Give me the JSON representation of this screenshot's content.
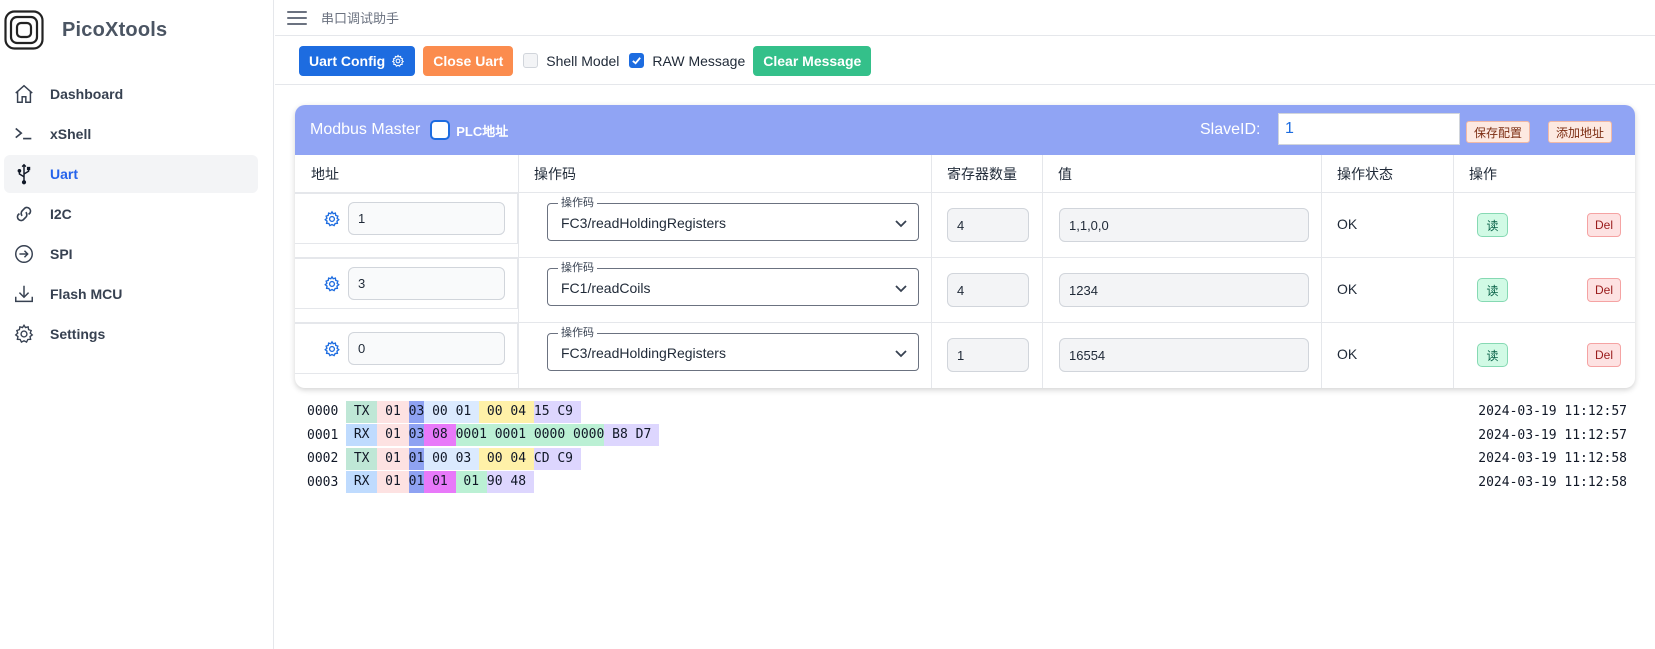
{
  "app": {
    "name": "PicoXtools",
    "header_title": "串口调试助手"
  },
  "sidebar": {
    "items": [
      {
        "label": "Dashboard",
        "icon": "home-icon"
      },
      {
        "label": "xShell",
        "icon": "terminal-icon"
      },
      {
        "label": "Uart",
        "icon": "usb-icon",
        "active": true
      },
      {
        "label": "I2C",
        "icon": "link-icon"
      },
      {
        "label": "SPI",
        "icon": "arrow-circle-icon"
      },
      {
        "label": "Flash MCU",
        "icon": "download-icon"
      },
      {
        "label": "Settings",
        "icon": "gear-icon"
      }
    ]
  },
  "toolbar": {
    "uart_config_label": "Uart Config",
    "close_uart_label": "Close Uart",
    "shell_model_label": "Shell Model",
    "shell_model_checked": false,
    "raw_message_label": "RAW Message",
    "raw_message_checked": true,
    "clear_message_label": "Clear Message"
  },
  "modbus": {
    "title": "Modbus Master",
    "plc_label": "PLC地址",
    "slave_label": "SlaveID:",
    "slave_id": "1",
    "save_config_label": "保存配置",
    "add_address_label": "添加地址",
    "columns": [
      "地址",
      "操作码",
      "寄存器数量",
      "值",
      "操作状态",
      "操作"
    ],
    "opcode_legend": "操作码",
    "read_label": "读",
    "del_label": "Del",
    "rows": [
      {
        "address": "1",
        "opcode": "FC3/readHoldingRegisters",
        "count": "4",
        "value": "1,1,0,0",
        "status": "OK"
      },
      {
        "address": "3",
        "opcode": "FC1/readCoils",
        "count": "4",
        "value": "1234",
        "status": "OK"
      },
      {
        "address": "0",
        "opcode": "FC3/readHoldingRegisters",
        "count": "1",
        "value": "16554",
        "status": "OK"
      }
    ]
  },
  "log": {
    "lines": [
      {
        "index": "0000",
        "timestamp": "2024-03-19 11:12:57",
        "segments": [
          {
            "text": " TX ",
            "color": "#bfe7d6"
          },
          {
            "text": " 01 ",
            "color": "#fde2e2"
          },
          {
            "text": "03",
            "color": "#8ea2f2"
          },
          {
            "text": " 00 01 ",
            "color": "#dbeafe"
          },
          {
            "text": " 00 04 ",
            "color": "#fff1a8"
          },
          {
            "text": "15 C9 ",
            "color": "#ddd6fe"
          }
        ]
      },
      {
        "index": "0001",
        "timestamp": "2024-03-19 11:12:57",
        "segments": [
          {
            "text": " RX ",
            "color": "#bfdbfe"
          },
          {
            "text": " 01 ",
            "color": "#fde2e2"
          },
          {
            "text": "03",
            "color": "#8ea2f2"
          },
          {
            "text": " 08 ",
            "color": "#e879f9"
          },
          {
            "text": "0001 0001 0000 0000",
            "color": "#bbf0d4"
          },
          {
            "text": " B8 D7 ",
            "color": "#ddd6fe"
          }
        ]
      },
      {
        "index": "0002",
        "timestamp": "2024-03-19 11:12:58",
        "segments": [
          {
            "text": " TX ",
            "color": "#bfe7d6"
          },
          {
            "text": " 01 ",
            "color": "#fde2e2"
          },
          {
            "text": "01",
            "color": "#8ea2f2"
          },
          {
            "text": " 00 03 ",
            "color": "#dbeafe"
          },
          {
            "text": " 00 04 ",
            "color": "#fff1a8"
          },
          {
            "text": "CD C9 ",
            "color": "#ddd6fe"
          }
        ]
      },
      {
        "index": "0003",
        "timestamp": "2024-03-19 11:12:58",
        "segments": [
          {
            "text": " RX ",
            "color": "#bfdbfe"
          },
          {
            "text": " 01 ",
            "color": "#fde2e2"
          },
          {
            "text": "01",
            "color": "#8ea2f2"
          },
          {
            "text": " 01 ",
            "color": "#e879f9"
          },
          {
            "text": " 01 ",
            "color": "#bbf0d4"
          },
          {
            "text": "90 48 ",
            "color": "#ddd6fe"
          }
        ]
      }
    ]
  }
}
